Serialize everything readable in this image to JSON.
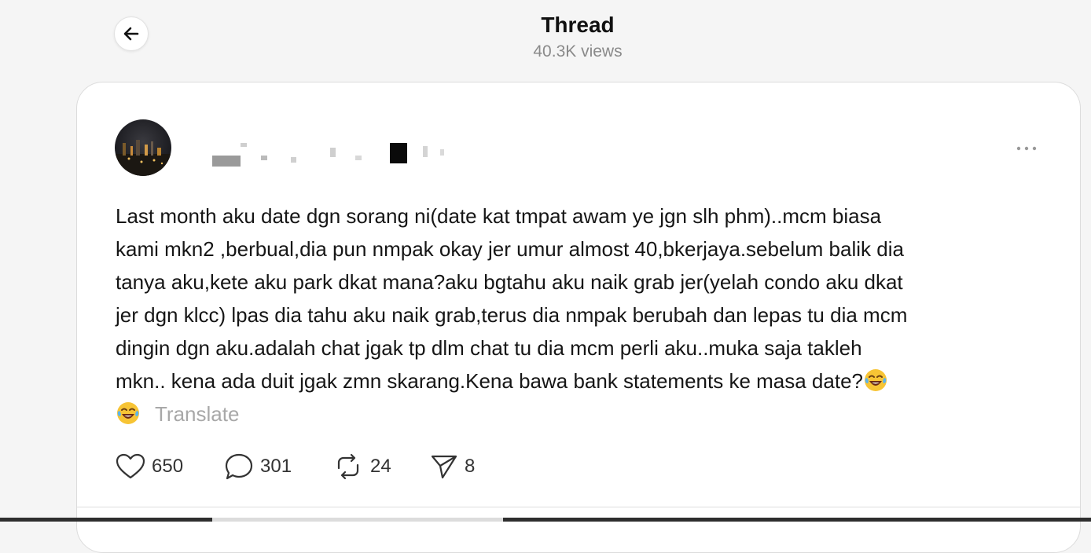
{
  "header": {
    "title": "Thread",
    "views": "40.3K views"
  },
  "post": {
    "text_lines": [
      "Last month aku date dgn sorang ni(date kat tmpat awam ye jgn slh phm)..mcm biasa",
      "kami mkn2 ,berbual,dia pun nmpak okay jer umur almost 40,bkerjaya.sebelum balik dia",
      "tanya aku,kete aku park dkat mana?aku bgtahu aku naik grab jer(yelah condo aku dkat",
      "jer dgn klcc) lpas dia tahu aku naik grab,terus dia nmpak berubah dan lepas tu dia mcm",
      "dingin dgn aku.adalah chat jgak tp dlm chat tu dia mcm perli aku..muka saja takleh",
      "mkn.. kena ada duit jgak zmn skarang.Kena bawa bank statements ke masa date?"
    ],
    "translate_label": "Translate",
    "emoji_name": "laughing-tears-emoji"
  },
  "actions": {
    "likes": "650",
    "replies": "301",
    "reposts": "24",
    "shares": "8"
  },
  "icons": {
    "back": "arrow-left-icon",
    "more": "more-dots-icon",
    "like": "heart-icon",
    "reply": "comment-icon",
    "repost": "repost-icon",
    "share": "send-icon"
  }
}
